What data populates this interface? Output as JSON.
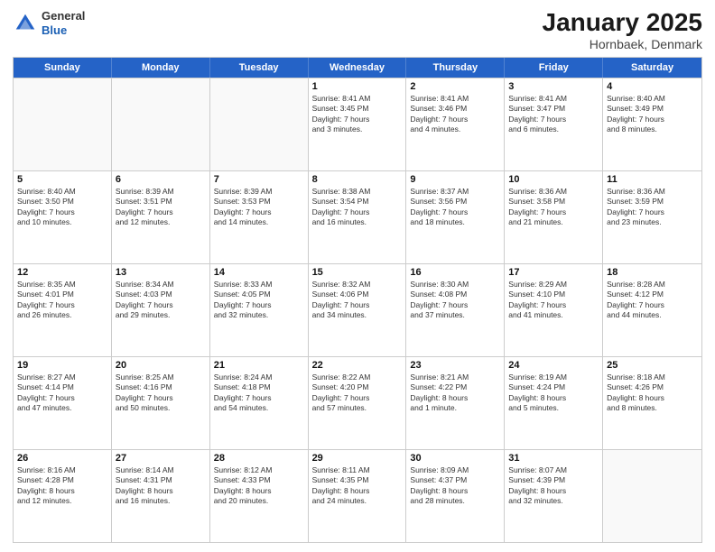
{
  "header": {
    "logo_general": "General",
    "logo_blue": "Blue",
    "month_title": "January 2025",
    "location": "Hornbaek, Denmark"
  },
  "weekdays": [
    "Sunday",
    "Monday",
    "Tuesday",
    "Wednesday",
    "Thursday",
    "Friday",
    "Saturday"
  ],
  "rows": [
    [
      {
        "day": "",
        "info": "",
        "empty": true
      },
      {
        "day": "",
        "info": "",
        "empty": true
      },
      {
        "day": "",
        "info": "",
        "empty": true
      },
      {
        "day": "1",
        "info": "Sunrise: 8:41 AM\nSunset: 3:45 PM\nDaylight: 7 hours\nand 3 minutes.",
        "empty": false
      },
      {
        "day": "2",
        "info": "Sunrise: 8:41 AM\nSunset: 3:46 PM\nDaylight: 7 hours\nand 4 minutes.",
        "empty": false
      },
      {
        "day": "3",
        "info": "Sunrise: 8:41 AM\nSunset: 3:47 PM\nDaylight: 7 hours\nand 6 minutes.",
        "empty": false
      },
      {
        "day": "4",
        "info": "Sunrise: 8:40 AM\nSunset: 3:49 PM\nDaylight: 7 hours\nand 8 minutes.",
        "empty": false
      }
    ],
    [
      {
        "day": "5",
        "info": "Sunrise: 8:40 AM\nSunset: 3:50 PM\nDaylight: 7 hours\nand 10 minutes.",
        "empty": false
      },
      {
        "day": "6",
        "info": "Sunrise: 8:39 AM\nSunset: 3:51 PM\nDaylight: 7 hours\nand 12 minutes.",
        "empty": false
      },
      {
        "day": "7",
        "info": "Sunrise: 8:39 AM\nSunset: 3:53 PM\nDaylight: 7 hours\nand 14 minutes.",
        "empty": false
      },
      {
        "day": "8",
        "info": "Sunrise: 8:38 AM\nSunset: 3:54 PM\nDaylight: 7 hours\nand 16 minutes.",
        "empty": false
      },
      {
        "day": "9",
        "info": "Sunrise: 8:37 AM\nSunset: 3:56 PM\nDaylight: 7 hours\nand 18 minutes.",
        "empty": false
      },
      {
        "day": "10",
        "info": "Sunrise: 8:36 AM\nSunset: 3:58 PM\nDaylight: 7 hours\nand 21 minutes.",
        "empty": false
      },
      {
        "day": "11",
        "info": "Sunrise: 8:36 AM\nSunset: 3:59 PM\nDaylight: 7 hours\nand 23 minutes.",
        "empty": false
      }
    ],
    [
      {
        "day": "12",
        "info": "Sunrise: 8:35 AM\nSunset: 4:01 PM\nDaylight: 7 hours\nand 26 minutes.",
        "empty": false
      },
      {
        "day": "13",
        "info": "Sunrise: 8:34 AM\nSunset: 4:03 PM\nDaylight: 7 hours\nand 29 minutes.",
        "empty": false
      },
      {
        "day": "14",
        "info": "Sunrise: 8:33 AM\nSunset: 4:05 PM\nDaylight: 7 hours\nand 32 minutes.",
        "empty": false
      },
      {
        "day": "15",
        "info": "Sunrise: 8:32 AM\nSunset: 4:06 PM\nDaylight: 7 hours\nand 34 minutes.",
        "empty": false
      },
      {
        "day": "16",
        "info": "Sunrise: 8:30 AM\nSunset: 4:08 PM\nDaylight: 7 hours\nand 37 minutes.",
        "empty": false
      },
      {
        "day": "17",
        "info": "Sunrise: 8:29 AM\nSunset: 4:10 PM\nDaylight: 7 hours\nand 41 minutes.",
        "empty": false
      },
      {
        "day": "18",
        "info": "Sunrise: 8:28 AM\nSunset: 4:12 PM\nDaylight: 7 hours\nand 44 minutes.",
        "empty": false
      }
    ],
    [
      {
        "day": "19",
        "info": "Sunrise: 8:27 AM\nSunset: 4:14 PM\nDaylight: 7 hours\nand 47 minutes.",
        "empty": false
      },
      {
        "day": "20",
        "info": "Sunrise: 8:25 AM\nSunset: 4:16 PM\nDaylight: 7 hours\nand 50 minutes.",
        "empty": false
      },
      {
        "day": "21",
        "info": "Sunrise: 8:24 AM\nSunset: 4:18 PM\nDaylight: 7 hours\nand 54 minutes.",
        "empty": false
      },
      {
        "day": "22",
        "info": "Sunrise: 8:22 AM\nSunset: 4:20 PM\nDaylight: 7 hours\nand 57 minutes.",
        "empty": false
      },
      {
        "day": "23",
        "info": "Sunrise: 8:21 AM\nSunset: 4:22 PM\nDaylight: 8 hours\nand 1 minute.",
        "empty": false
      },
      {
        "day": "24",
        "info": "Sunrise: 8:19 AM\nSunset: 4:24 PM\nDaylight: 8 hours\nand 5 minutes.",
        "empty": false
      },
      {
        "day": "25",
        "info": "Sunrise: 8:18 AM\nSunset: 4:26 PM\nDaylight: 8 hours\nand 8 minutes.",
        "empty": false
      }
    ],
    [
      {
        "day": "26",
        "info": "Sunrise: 8:16 AM\nSunset: 4:28 PM\nDaylight: 8 hours\nand 12 minutes.",
        "empty": false
      },
      {
        "day": "27",
        "info": "Sunrise: 8:14 AM\nSunset: 4:31 PM\nDaylight: 8 hours\nand 16 minutes.",
        "empty": false
      },
      {
        "day": "28",
        "info": "Sunrise: 8:12 AM\nSunset: 4:33 PM\nDaylight: 8 hours\nand 20 minutes.",
        "empty": false
      },
      {
        "day": "29",
        "info": "Sunrise: 8:11 AM\nSunset: 4:35 PM\nDaylight: 8 hours\nand 24 minutes.",
        "empty": false
      },
      {
        "day": "30",
        "info": "Sunrise: 8:09 AM\nSunset: 4:37 PM\nDaylight: 8 hours\nand 28 minutes.",
        "empty": false
      },
      {
        "day": "31",
        "info": "Sunrise: 8:07 AM\nSunset: 4:39 PM\nDaylight: 8 hours\nand 32 minutes.",
        "empty": false
      },
      {
        "day": "",
        "info": "",
        "empty": true
      }
    ]
  ]
}
